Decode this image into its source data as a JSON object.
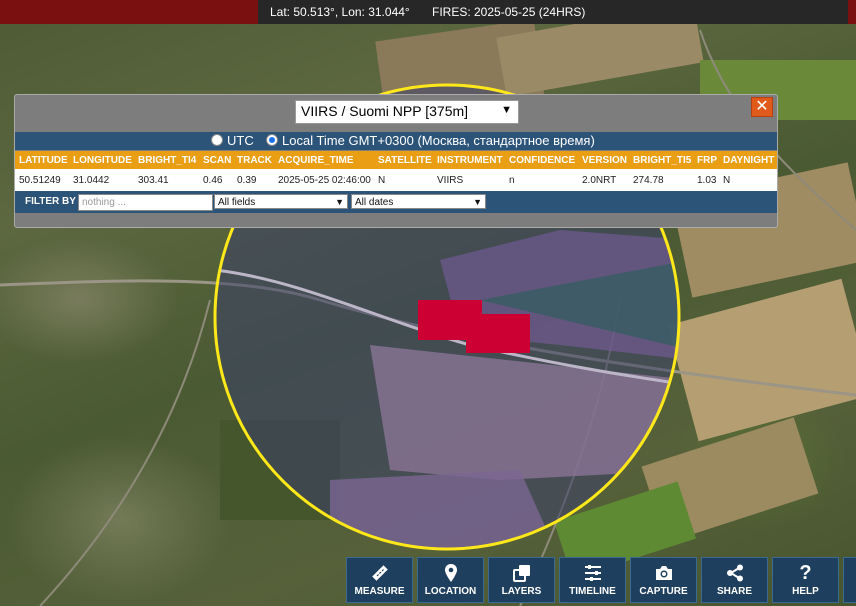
{
  "header": {
    "coord_readout": "Lat: 50.513°, Lon: 31.044°",
    "fires_readout": "FIRES: 2025-05-25 (24HRS)"
  },
  "panel": {
    "sensor_selected": "VIIRS / Suomi NPP [375m]",
    "close_label": "✕",
    "tz_utc_label": "UTC",
    "tz_local_label": "Local Time GMT+0300 (Москва, стандартное время)",
    "columns": [
      "LATITUDE",
      "LONGITUDE",
      "BRIGHT_TI4",
      "SCAN",
      "TRACK",
      "ACQUIRE_TIME",
      "SATELLITE",
      "INSTRUMENT",
      "CONFIDENCE",
      "VERSION",
      "BRIGHT_TI5",
      "FRP",
      "DAYNIGHT"
    ],
    "row": [
      "50.51249",
      "31.0442",
      "303.41",
      "0.46",
      "0.39",
      "2025-05-25 02:46:00",
      "N",
      "VIIRS",
      "n",
      "2.0NRT",
      "274.78",
      "1.03",
      "N"
    ],
    "filter_label": "FILTER BY",
    "filter_placeholder": "nothing ...",
    "field_select": "All fields",
    "date_select": "All dates"
  },
  "toolbar": {
    "items": [
      {
        "label": "MEASURE",
        "icon": "ruler-icon"
      },
      {
        "label": "LOCATION",
        "icon": "map-pin-icon"
      },
      {
        "label": "LAYERS",
        "icon": "layers-icon"
      },
      {
        "label": "TIMELINE",
        "icon": "sliders-icon"
      },
      {
        "label": "CAPTURE",
        "icon": "camera-icon"
      },
      {
        "label": "SHARE",
        "icon": "share-icon"
      },
      {
        "label": "HELP",
        "icon": "question-icon"
      }
    ]
  },
  "colors": {
    "fire_marker": "#cc0033",
    "radius_ring": "#ffe81a",
    "panel_header": "#e99e14",
    "panel_bar": "#2c5378"
  }
}
